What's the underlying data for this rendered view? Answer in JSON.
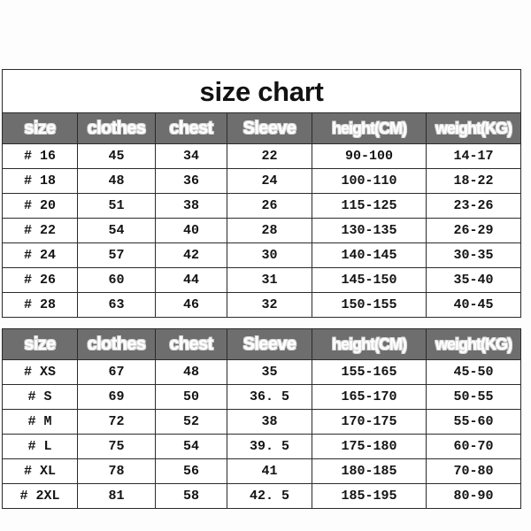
{
  "title": "size chart",
  "columns": [
    "size",
    "clothes",
    "chest",
    "Sleeve",
    "height(CM)",
    "weight(KG)"
  ],
  "tables": [
    {
      "name": "kids-size-table",
      "headers": [
        "size",
        "clothes",
        "chest",
        "Sleeve",
        "height(CM)",
        "weight(KG)"
      ],
      "rows": [
        [
          "# 16",
          "45",
          "34",
          "22",
          "90-100",
          "14-17"
        ],
        [
          "# 18",
          "48",
          "36",
          "24",
          "100-110",
          "18-22"
        ],
        [
          "# 20",
          "51",
          "38",
          "26",
          "115-125",
          "23-26"
        ],
        [
          "# 22",
          "54",
          "40",
          "28",
          "130-135",
          "26-29"
        ],
        [
          "# 24",
          "57",
          "42",
          "30",
          "140-145",
          "30-35"
        ],
        [
          "# 26",
          "60",
          "44",
          "31",
          "145-150",
          "35-40"
        ],
        [
          "# 28",
          "63",
          "46",
          "32",
          "150-155",
          "40-45"
        ]
      ]
    },
    {
      "name": "adult-size-table",
      "headers": [
        "size",
        "clothes",
        "chest",
        "Sleeve",
        "height(CM)",
        "weight(KG)"
      ],
      "rows": [
        [
          "# XS",
          "67",
          "48",
          "35",
          "155-165",
          "45-50"
        ],
        [
          "# S",
          "69",
          "50",
          "36. 5",
          "165-170",
          "50-55"
        ],
        [
          "# M",
          "72",
          "52",
          "38",
          "170-175",
          "55-60"
        ],
        [
          "# L",
          "75",
          "54",
          "39. 5",
          "175-180",
          "60-70"
        ],
        [
          "# XL",
          "78",
          "56",
          "41",
          "180-185",
          "70-80"
        ],
        [
          "# 2XL",
          "81",
          "58",
          "42. 5",
          "185-195",
          "80-90"
        ]
      ]
    }
  ],
  "colors": {
    "header_background": "#6e6e6e",
    "header_text": "#ffffff",
    "border": "#2b2b2b",
    "cell_background": "#ffffff",
    "page_background": "#fdfdfd",
    "title_text": "#121212"
  }
}
